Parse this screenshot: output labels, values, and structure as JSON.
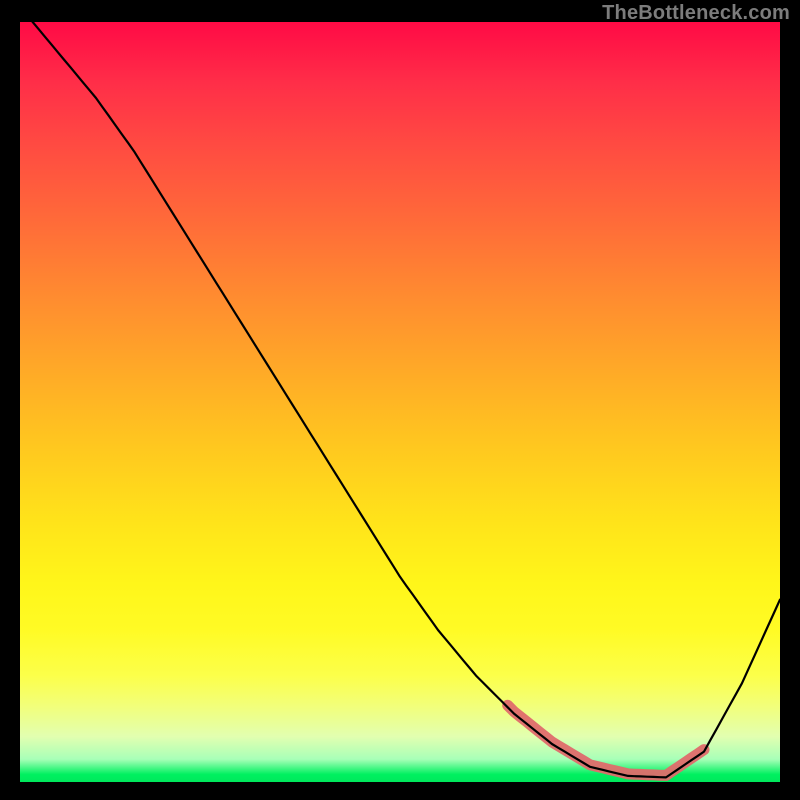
{
  "watermark": "TheBottleneck.com",
  "chart_data": {
    "type": "line",
    "title": "",
    "xlabel": "",
    "ylabel": "",
    "xlim": [
      0,
      100
    ],
    "ylim": [
      0,
      100
    ],
    "x": [
      0,
      5,
      10,
      15,
      20,
      25,
      30,
      35,
      40,
      45,
      50,
      55,
      60,
      65,
      70,
      75,
      80,
      85,
      90,
      95,
      100
    ],
    "y": [
      102,
      96,
      90,
      83,
      75,
      67,
      59,
      51,
      43,
      35,
      27,
      20,
      14,
      9,
      5,
      2,
      0.8,
      0.6,
      4,
      13,
      24
    ],
    "highlight_range_x": [
      64,
      90
    ],
    "background": "rainbow-gradient",
    "annotations": []
  }
}
